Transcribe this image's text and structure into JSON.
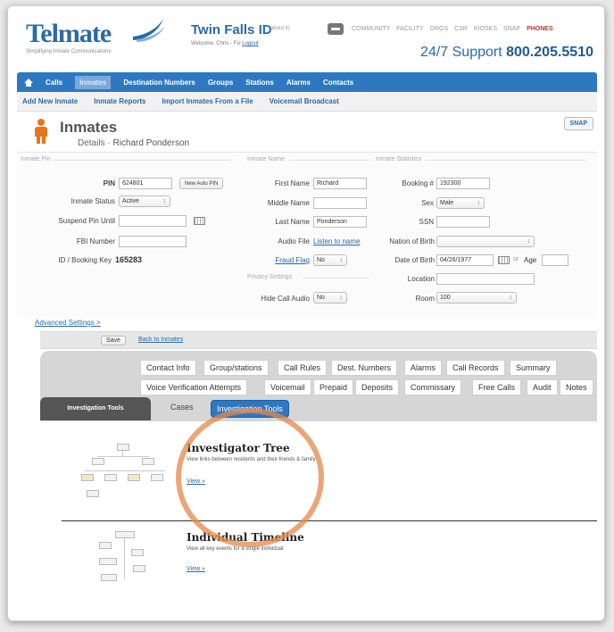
{
  "header": {
    "logo_text": "Telmate",
    "logo_tagline": "Simplifying Inmate Communications",
    "facility_name": "Twin Falls ID",
    "facility_sub": "(about it)",
    "welcome_text": "Welcome, Chris - Fsi",
    "logout_label": "Logout",
    "top_links": [
      "COMMUNITY",
      "FACILITY",
      "ORGS",
      "CSR",
      "KIOSKS",
      "SNAP",
      "PHONES"
    ],
    "support_text": "24/7 Support",
    "support_number": "800.205.5510"
  },
  "nav": {
    "items": [
      "Calls",
      "Inmates",
      "Destination Numbers",
      "Groups",
      "Stations",
      "Alarms",
      "Contacts"
    ],
    "active": "Inmates"
  },
  "subnav": {
    "items": [
      "Add New Inmate",
      "Inmate Reports",
      "Import Inmates From a File",
      "Voicemail Broadcast"
    ]
  },
  "page": {
    "title": "Inmates",
    "details_prefix": "Details",
    "inmate_name": "Richard Ponderson",
    "snap_label": "SNAP"
  },
  "pin_section": {
    "title": "Inmate Pin",
    "pin_label": "PIN",
    "pin_value": "624801",
    "new_auto_pin_label": "New Auto PIN",
    "status_label": "Inmate Status",
    "status_value": "Active",
    "suspend_label": "Suspend Pin Until",
    "suspend_value": "",
    "fbi_label": "FBI Number",
    "fbi_value": "",
    "booking_key_label": "ID / Booking Key",
    "booking_key_value": "165283"
  },
  "name_section": {
    "title": "Inmate Name",
    "first_label": "First Name",
    "first_value": "Richard",
    "middle_label": "Middle Name",
    "middle_value": "",
    "last_label": "Last Name",
    "last_value": "Ponderson",
    "audio_label": "Audio File",
    "audio_link": "Listen to name",
    "fraud_label": "Fraud Flag",
    "fraud_value": "No",
    "privacy_title": "Privacy Settings",
    "hide_audio_label": "Hide Call Audio",
    "hide_audio_value": "No"
  },
  "stats_section": {
    "title": "Inmate Statistics",
    "booking_label": "Booking #",
    "booking_value": "192300",
    "sex_label": "Sex",
    "sex_value": "Male",
    "ssn_label": "SSN",
    "ssn_value": "",
    "nation_label": "Nation of Birth",
    "nation_value": "",
    "dob_label": "Date of Birth",
    "dob_value": "04/26/1977",
    "or_text": "or",
    "age_label": "Age",
    "age_value": "",
    "location_label": "Location",
    "location_value": "",
    "room_label": "Room",
    "room_value": "100"
  },
  "footer_actions": {
    "advanced_label": "Advanced Settings >",
    "save_label": "Save",
    "back_label": "Back to Inmates"
  },
  "tabs": {
    "row1": [
      "Contact Info",
      "Group/stations",
      "Call Rules",
      "Dest. Numbers",
      "Alarms",
      "Call Records",
      "Summary"
    ],
    "row2": [
      "Voice Verification Attempts",
      "Voicemail",
      "Prepaid",
      "Deposits",
      "Commissary",
      "Free Calls",
      "Audit",
      "Notes"
    ],
    "side_tab": "Investigation Tools",
    "cases_tab": "Cases",
    "active_tab": "Investigation Tools"
  },
  "tools": [
    {
      "title": "Investigator Tree",
      "description": "View links between residents and their friends & family",
      "link": "View »"
    },
    {
      "title": "Individual Timeline",
      "description": "View all key events for a single individual",
      "link": "View »"
    }
  ],
  "colors": {
    "brand_blue": "#2e78c2",
    "accent_orange": "#e8741c",
    "highlight_circle": "#e28a4a"
  }
}
